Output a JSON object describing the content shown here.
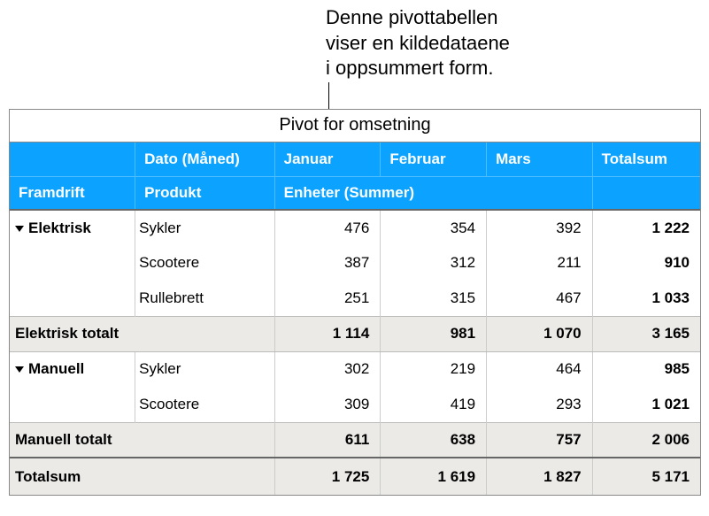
{
  "callout": {
    "line1": "Denne pivottabellen",
    "line2": "viser en kildedataene",
    "line3": "i oppsummert form."
  },
  "pivot": {
    "title": "Pivot for omsetning",
    "header": {
      "date": "Dato (Måned)",
      "months": {
        "jan": "Januar",
        "feb": "Februar",
        "mar": "Mars"
      },
      "total": "Totalsum",
      "category": "Framdrift",
      "product": "Produkt",
      "measure": "Enheter (Summer)"
    },
    "groups": [
      {
        "name": "Elektrisk",
        "rows": [
          {
            "product": "Sykler",
            "jan": "476",
            "feb": "354",
            "mar": "392",
            "total": "1 222"
          },
          {
            "product": "Scootere",
            "jan": "387",
            "feb": "312",
            "mar": "211",
            "total": "910"
          },
          {
            "product": "Rullebrett",
            "jan": "251",
            "feb": "315",
            "mar": "467",
            "total": "1 033"
          }
        ],
        "subtotal": {
          "label": "Elektrisk totalt",
          "jan": "1 114",
          "feb": "981",
          "mar": "1 070",
          "total": "3 165"
        }
      },
      {
        "name": "Manuell",
        "rows": [
          {
            "product": "Sykler",
            "jan": "302",
            "feb": "219",
            "mar": "464",
            "total": "985"
          },
          {
            "product": "Scootere",
            "jan": "309",
            "feb": "419",
            "mar": "293",
            "total": "1 021"
          }
        ],
        "subtotal": {
          "label": "Manuell totalt",
          "jan": "611",
          "feb": "638",
          "mar": "757",
          "total": "2 006"
        }
      }
    ],
    "grand": {
      "label": "Totalsum",
      "jan": "1 725",
      "feb": "1 619",
      "mar": "1 827",
      "total": "5 171"
    }
  }
}
